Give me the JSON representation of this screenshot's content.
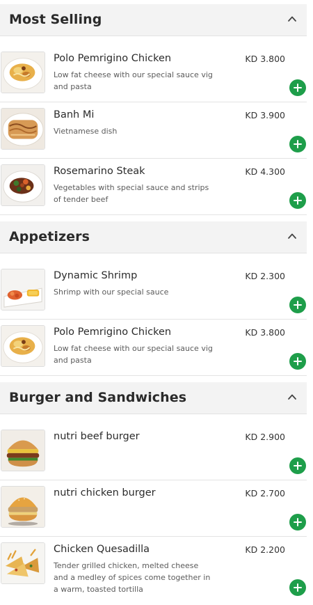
{
  "colors": {
    "header_bg": "#f3f3f3",
    "add_button": "#1e9e4a",
    "divider": "#e3e3e3"
  },
  "currency": "KD",
  "sections": [
    {
      "title": "Most Selling",
      "icon": "chevron-up-icon",
      "items": [
        {
          "name": "Polo Pemrigino Chicken",
          "description": "Low fat cheese with our special sauce vig and pasta",
          "price": "KD 3.800",
          "image": "pasta-plate"
        },
        {
          "name": "Banh Mi",
          "description": "Vietnamese dish",
          "price": "KD 3.900",
          "image": "banh-mi-plate"
        },
        {
          "name": "Rosemarino Steak",
          "description": "Vegetables with special sauce and strips of tender beef",
          "price": "KD 4.300",
          "image": "steak-plate"
        }
      ]
    },
    {
      "title": "Appetizers",
      "icon": "chevron-up-icon",
      "items": [
        {
          "name": "Dynamic Shrimp",
          "description": "Shrimp with our special sauce",
          "price": "KD 2.300",
          "image": "shrimp-plate"
        },
        {
          "name": "Polo Pemrigino Chicken",
          "description": "Low fat cheese with our special sauce vig and pasta",
          "price": "KD 3.800",
          "image": "pasta-plate"
        }
      ]
    },
    {
      "title": "Burger and Sandwiches",
      "icon": "chevron-up-icon",
      "items": [
        {
          "name": "nutri beef burger",
          "description": "",
          "price": "KD 2.900",
          "image": "beef-burger"
        },
        {
          "name": "nutri chicken burger",
          "description": "",
          "price": "KD 2.700",
          "image": "chicken-burger"
        },
        {
          "name": "Chicken Quesadilla",
          "description": "Tender grilled chicken, melted cheese and a medley of spices come together in a warm, toasted tortilla",
          "price": "KD 2.200",
          "image": "quesadilla-plate"
        }
      ]
    }
  ]
}
